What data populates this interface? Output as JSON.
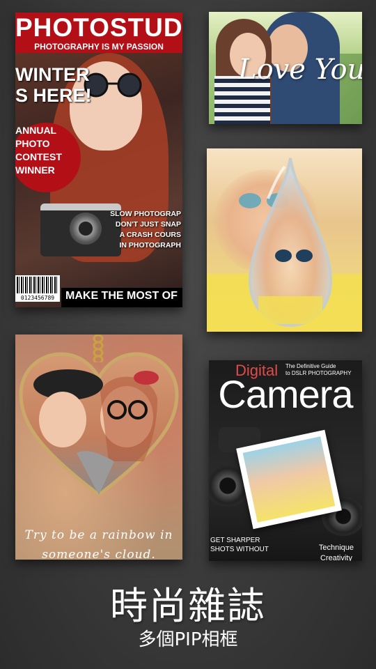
{
  "theme": {
    "background": "#3f3f3f",
    "accent_red": "#b30f17",
    "text": "#ffffff"
  },
  "tiles": [
    {
      "name": "photostudio-magazine",
      "masthead": "PHOTOSTUDIO",
      "tagline": "PHOTOGRAPHY IS MY PASSION",
      "headline": "WINTER\nS HERE!",
      "badge": "ANNUAL\nPHOTO\nCONTEST\nWINNER",
      "side_copy": "SLOW PHOTOGRAP\nDON'T JUST SNAP\nA CRASH COURS\nIN PHOTOGRAPH",
      "barcode_number": "0123456789",
      "bottom_line": "MAKE THE MOST OF"
    },
    {
      "name": "love-you-frame",
      "script_text": "Love You"
    },
    {
      "name": "water-drop-frame"
    },
    {
      "name": "heart-pendant-frame",
      "script_text": "Try to be a rainbow in\nsomeone's cloud."
    },
    {
      "name": "digital-camera-magazine",
      "kicker": "Digital",
      "guide": "The Definitive Guide\nto DSLR PHOTOGRAPHY",
      "title": "Camera",
      "left_copy": "GET SHARPER\nSHOTS WITHOUT",
      "right_copy": "Technique\nCreativity"
    }
  ],
  "footer": {
    "title": "時尚雜誌",
    "subtitle": "多個PIP相框"
  }
}
